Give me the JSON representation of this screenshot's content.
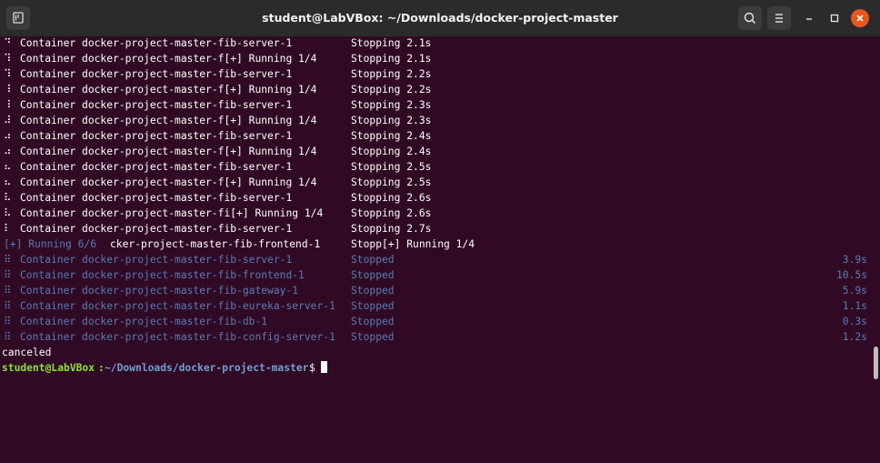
{
  "window": {
    "title": "student@LabVBox: ~/Downloads/docker-project-master"
  },
  "lines": [
    {
      "spin": "⠙",
      "name": "Container docker-project-master-fib-server-1",
      "status": "Stopping 2.1s"
    },
    {
      "spin": "⠹",
      "name": "Container docker-project-master-f[+] Running 1/4",
      "status": "Stopping 2.1s"
    },
    {
      "spin": "⠹",
      "name": "Container docker-project-master-fib-server-1",
      "status": "Stopping 2.2s"
    },
    {
      "spin": "⠸",
      "name": "Container docker-project-master-f[+] Running 1/4",
      "status": "Stopping 2.2s"
    },
    {
      "spin": "⠸",
      "name": "Container docker-project-master-fib-server-1",
      "status": "Stopping 2.3s"
    },
    {
      "spin": "⠼",
      "name": "Container docker-project-master-f[+] Running 1/4",
      "status": "Stopping 2.3s"
    },
    {
      "spin": "⠴",
      "name": "Container docker-project-master-fib-server-1",
      "status": "Stopping 2.4s"
    },
    {
      "spin": "⠴",
      "name": "Container docker-project-master-f[+] Running 1/4",
      "status": "Stopping 2.4s"
    },
    {
      "spin": "⠦",
      "name": "Container docker-project-master-fib-server-1",
      "status": "Stopping 2.5s"
    },
    {
      "spin": "⠦",
      "name": "Container docker-project-master-f[+] Running 1/4",
      "status": "Stopping 2.5s"
    },
    {
      "spin": "⠧",
      "name": "Container docker-project-master-fib-server-1",
      "status": "Stopping 2.6s"
    },
    {
      "spin": "⠧",
      "name": "Container docker-project-master-fi[+] Running 1/4",
      "status": "Stopping 2.6s"
    },
    {
      "spin": "⠇",
      "name": "Container docker-project-master-fib-server-1",
      "status": "Stopping 2.7s"
    }
  ],
  "overlap_line": {
    "prefix": "[+] Running 6/6",
    "rest": "cker-project-master-fib-frontend-1",
    "status": "Stopp[+] Running 1/4"
  },
  "stopped": [
    {
      "spin": "⠿",
      "name": "Container docker-project-master-fib-server-1",
      "status": "Stopped",
      "time": "3.9s"
    },
    {
      "spin": "⠿",
      "name": "Container docker-project-master-fib-frontend-1",
      "status": "Stopped",
      "time": "10.5s"
    },
    {
      "spin": "⠿",
      "name": "Container docker-project-master-fib-gateway-1",
      "status": "Stopped",
      "time": "5.9s"
    },
    {
      "spin": "⠿",
      "name": "Container docker-project-master-fib-eureka-server-1",
      "status": "Stopped",
      "time": "1.1s"
    },
    {
      "spin": "⠿",
      "name": "Container docker-project-master-fib-db-1",
      "status": "Stopped",
      "time": "0.3s"
    },
    {
      "spin": "⠿",
      "name": "Container docker-project-master-fib-config-server-1",
      "status": "Stopped",
      "time": "1.2s"
    }
  ],
  "canceled_text": "canceled",
  "prompt": {
    "user": "student@LabVBox",
    "sep": ":",
    "path": "~/Downloads/docker-project-master",
    "symbol": "$ "
  },
  "colors": {
    "background": "#300a24",
    "titlebar": "#2b2b2b",
    "dim_text": "#5b7bb5",
    "prompt_user": "#8ae234",
    "prompt_path": "#729fcf",
    "close_button": "#e9541f"
  },
  "icons": {
    "new_tab": "new-tab-icon",
    "search": "search-icon",
    "menu": "hamburger-menu-icon",
    "minimize": "minimize-icon",
    "maximize": "maximize-icon",
    "close": "close-icon"
  }
}
